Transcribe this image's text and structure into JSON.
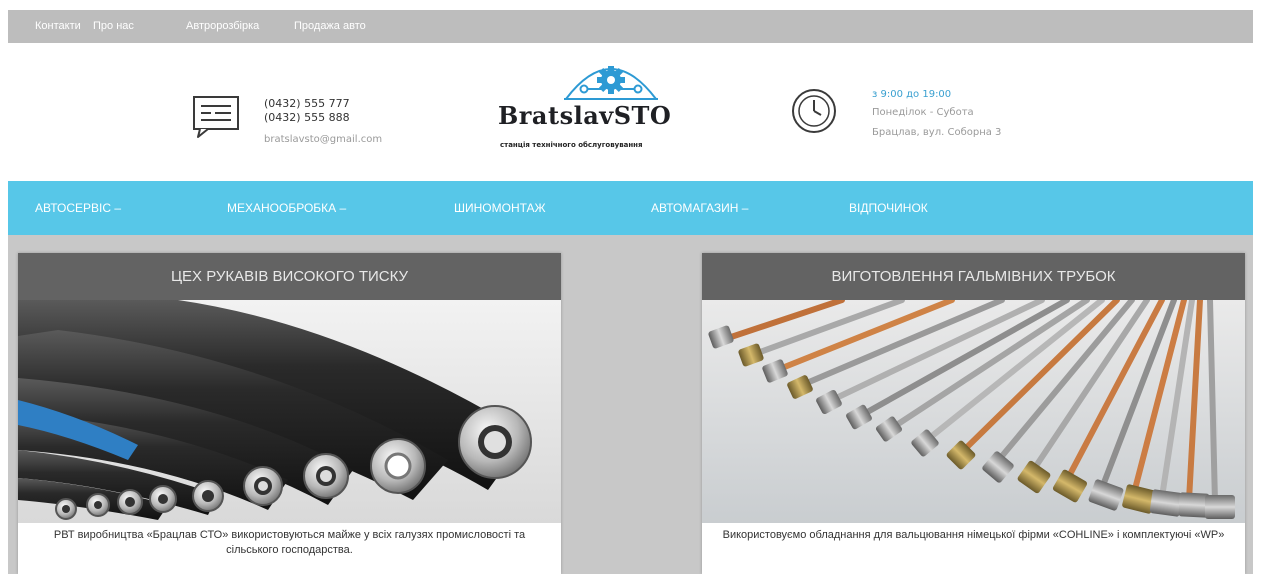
{
  "topnav": [
    "Контакти",
    "Про нас",
    "Автророзбірка",
    "Продажа авто"
  ],
  "contact": {
    "icon": "message-icon",
    "phone1": "(0432) 555 777",
    "phone2": "(0432) 555 888",
    "email": "bratslavsto@gmail.com"
  },
  "logo": {
    "name": "BratslavSTO",
    "tagline": "станція технічного обслуговування",
    "icon": "gear-wrench-logo-icon"
  },
  "schedule": {
    "icon": "clock-icon",
    "hours": "з 9:00 до 19:00",
    "days": "Понеділок - Субота",
    "address": "Брацлав, вул. Соборна 3"
  },
  "mainnav": [
    "АВТОСЕРВІС –",
    "МЕХАНООБРОБКА –",
    "ШИНОМОНТАЖ",
    "АВТОМАГАЗИН –",
    "ВІДПОЧИНОК"
  ],
  "cards": [
    {
      "title": "ЦЕХ РУКАВІВ ВИСОКОГО ТИСКУ",
      "caption": "РВТ виробництва «Брацлав СТО» використовуються майже у всіх галузях промисловості та сільського господарства."
    },
    {
      "title": "ВИГОТОВЛЕННЯ ГАЛЬМІВНИХ ТРУБОК",
      "caption": "Використовуємо обладнання для вальцювання німецької фірми «COHLINE» і комплектуючі «WP»"
    }
  ],
  "colors": {
    "topbar": "#bdbdbd",
    "nav": "#57c7e8",
    "card_header": "#636363",
    "hours": "#3aa0d0"
  }
}
